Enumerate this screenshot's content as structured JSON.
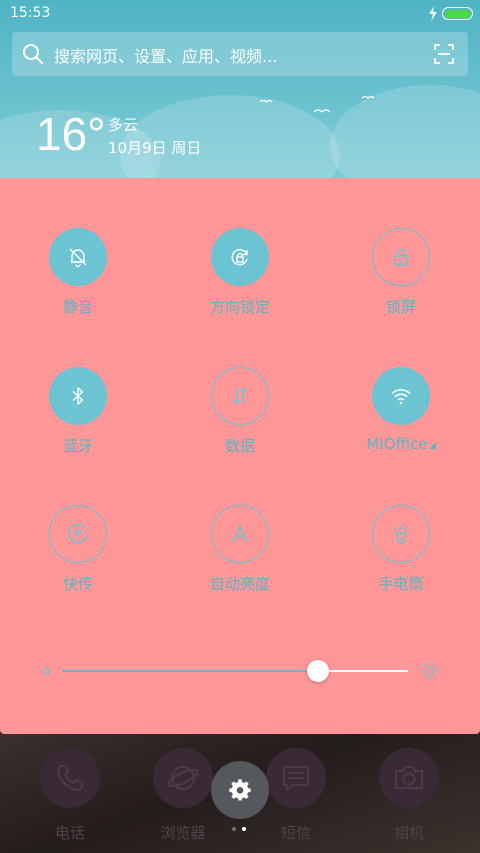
{
  "status_bar": {
    "time": "15:53",
    "battery_color": "#49d94a"
  },
  "search": {
    "placeholder": "搜索网页、设置、应用、视频..."
  },
  "weather": {
    "temperature": "16°",
    "condition": "多云",
    "date": "10月9日 周日"
  },
  "colors": {
    "panel_bg": "#ff9698",
    "accent": "#6cc3d2",
    "label": "#5ab6c4"
  },
  "toggles": [
    {
      "label": "静音",
      "icon": "bell-off-icon",
      "state": "on"
    },
    {
      "label": "方向锁定",
      "icon": "rotation-lock-icon",
      "state": "on"
    },
    {
      "label": "锁屏",
      "icon": "lock-icon",
      "state": "off"
    },
    {
      "label": "蓝牙",
      "icon": "bluetooth-icon",
      "state": "on"
    },
    {
      "label": "数据",
      "icon": "data-arrows-icon",
      "state": "off"
    },
    {
      "label": "MIOffice",
      "icon": "wifi-icon",
      "state": "on"
    },
    {
      "label": "快传",
      "icon": "share-transfer-icon",
      "state": "off"
    },
    {
      "label": "自动亮度",
      "icon": "auto-brightness-icon",
      "state": "off"
    },
    {
      "label": "手电筒",
      "icon": "flashlight-icon",
      "state": "off"
    }
  ],
  "brightness": {
    "level": 0.74
  },
  "dock": {
    "apps": [
      {
        "label": "电话",
        "icon": "phone-icon"
      },
      {
        "label": "浏览器",
        "icon": "browser-icon"
      },
      {
        "label": "短信",
        "icon": "message-icon"
      },
      {
        "label": "相机",
        "icon": "camera-icon"
      }
    ],
    "settings_icon": "gear-icon",
    "active_page": 2,
    "page_count": 2
  }
}
